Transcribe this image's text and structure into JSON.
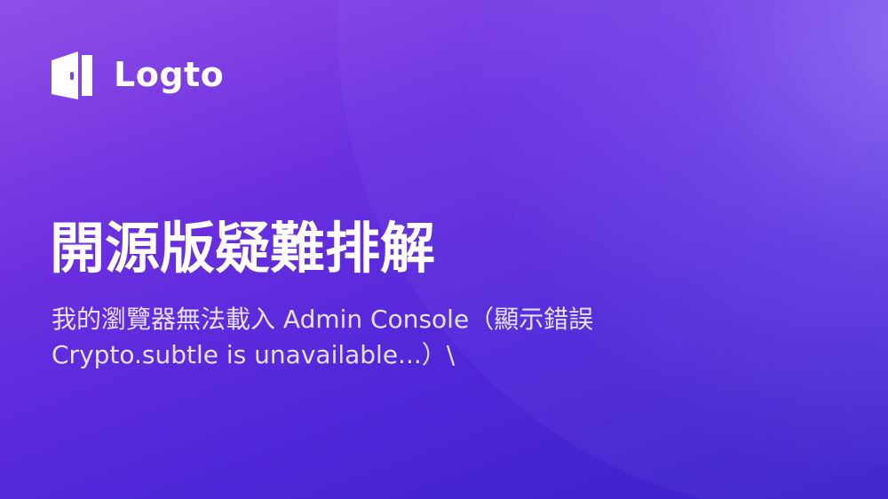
{
  "brand": {
    "name": "Logto",
    "logo_icon": "logto-door-icon"
  },
  "headline": "開源版疑難排解",
  "description": {
    "line1": "我的瀏覽器無法載入 Admin Console（顯示錯誤",
    "line2": "Crypto.subtle is unavailable...）\\"
  },
  "colors": {
    "background_start": "#8f4fe6",
    "background_end": "#3a20c9",
    "text": "#ffffff"
  }
}
